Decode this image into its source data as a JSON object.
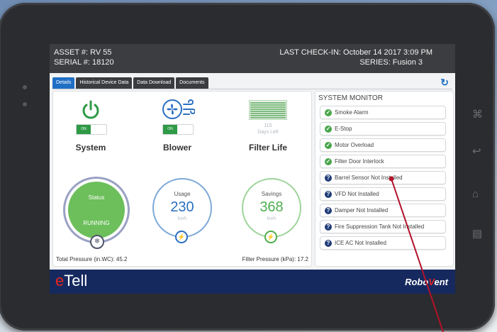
{
  "header": {
    "asset": "ASSET #: RV 55",
    "serial": "SERIAL #: 18120",
    "last_checkin": "LAST CHECK-IN: October 14 2017 3:09 PM",
    "series": "SERIES: Fusion 3"
  },
  "tabs": [
    "Details",
    "Historical Device Data",
    "Data Download",
    "Documents"
  ],
  "features": {
    "system": {
      "toggle": "ON",
      "label": "System"
    },
    "blower": {
      "toggle": "ON",
      "label": "Blower"
    },
    "filter": {
      "days": "115",
      "days_label": "Days Left",
      "label": "Filter Life"
    }
  },
  "gauges": {
    "status": {
      "title": "Status",
      "value": "RUNNING"
    },
    "usage": {
      "title": "Usage",
      "value": "230",
      "unit": "kwh"
    },
    "savings": {
      "title": "Savings",
      "value": "368",
      "unit": "kwh"
    }
  },
  "readings": {
    "total_pressure": "Total Pressure (in.WC): 45.2",
    "filter_pressure": "Filter Pressure (kPa): 17.2"
  },
  "system_monitor": {
    "title": "SYSTEM MONITOR",
    "items": [
      {
        "label": "Smoke Alarm",
        "status": "ok"
      },
      {
        "label": "E-Stop",
        "status": "ok"
      },
      {
        "label": "Motor Overload",
        "status": "ok"
      },
      {
        "label": "Filter Door Interlock",
        "status": "ok"
      },
      {
        "label": "Barrel Sensor Not Installed",
        "status": "unknown"
      },
      {
        "label": "VFD Not Installed",
        "status": "unknown"
      },
      {
        "label": "Damper Not Installed",
        "status": "unknown"
      },
      {
        "label": "Fire Suppression Tank Not Installed",
        "status": "unknown"
      },
      {
        "label": "ICE AC Not Installed",
        "status": "unknown"
      }
    ]
  },
  "footer": {
    "brand_e": "e",
    "brand_rest": "Tell",
    "logo_left": "Robo",
    "logo_mid": "V",
    "logo_right": "ent"
  },
  "colors": {
    "accent": "#1f6fc5",
    "ok": "#49a54b",
    "status_green": "#6cbf5b",
    "footer": "#16295f",
    "brand_red": "#e4251f"
  }
}
